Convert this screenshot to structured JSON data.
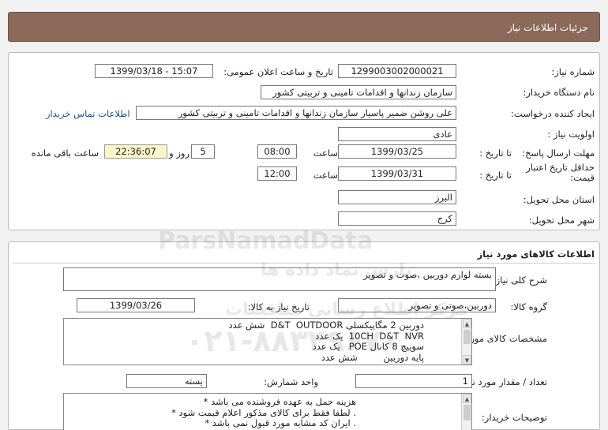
{
  "header": {
    "title": "جزئیات اطلاعات نیاز"
  },
  "need_info": {
    "need_number_label": "شماره نیاز:",
    "need_number": "1299003002000021",
    "announce_label": "تاریخ و ساعت اعلان عمومی:",
    "announce_value": "1399/03/18 - 15:07",
    "buyer_org_label": "نام دستگاه خریدار:",
    "buyer_org": "سازمان زندانها و اقدامات تامینی و تربیتی کشور",
    "requester_label": "ایجاد کننده درخواست:",
    "requester": "علی روشن ضمیر پاسیار سازمان زندانها و اقدامات تامینی و تربیتی کشور",
    "contact_link": "اطلاعات تماس خریدار",
    "priority_label": "اولویت نیاز :",
    "priority": "عادی",
    "deadline_label": "مهلت ارسال پاسخ:",
    "until_date_label": "تا تاریخ :",
    "deadline_date": "1399/03/25",
    "time_label": "ساعت",
    "deadline_time": "08:00",
    "days_value": "5",
    "days_label": "روز و",
    "remaining_time": "22:36:07",
    "remaining_label": "ساعت باقی مانده",
    "validity_label": "حداقل تاریخ اعتبار قیمت:",
    "validity_until_label": "تا تاریخ :",
    "validity_date": "1399/03/31",
    "validity_time_label": "ساعت",
    "validity_time": "12:00",
    "province_label": "استان محل تحویل:",
    "province": "البرز",
    "city_label": "شهر محل تحویل:",
    "city": "کرج"
  },
  "goods": {
    "title": "اطلاعات کالاهای مورد نیاز",
    "desc_label": "شرح کلی نیاز:",
    "desc": "بسته لوازم دوربین ،صوت و تصویر",
    "group_label": "گروه کالا:",
    "group": "دوربین،صوتی و تصویر",
    "need_date_label": "تاریخ نیاز به کالا:",
    "need_date": "1399/03/26",
    "specs_label": "مشخصات کالای مورد نیاز:",
    "spec_lines": [
      "دوربین 2 مگاپیکسلی D&T  OUTDOOR  شش عدد",
      "10CH  D&T  NVR  یک عدد",
      "سوییچ 8 کانال POE   یک عدد",
      "پایه دوربین         شش عدد"
    ],
    "count_label": "تعداد / مقدار مورد نیاز:",
    "count": "1",
    "unit_label": "واحد شمارش:",
    "unit": "بسته",
    "buyer_notes_label": "توضیحات خریدار:",
    "notes_lines": [
      "هزینه حمل به عهده فروشنده می باشد *",
      ". لطفا فقط برای کالای مذکور اعلام قیمت شود *",
      ". ایران کد مشابه مورد قبول نمی باشد *"
    ]
  },
  "watermark": {
    "brand": "ParsNamadData",
    "line1": "پارس نماد داده ها",
    "line2": "مرکز اطلاع رسانی مناقصات",
    "phone": "۰۲۱-۸۸۳۴۹۶۷۰"
  }
}
